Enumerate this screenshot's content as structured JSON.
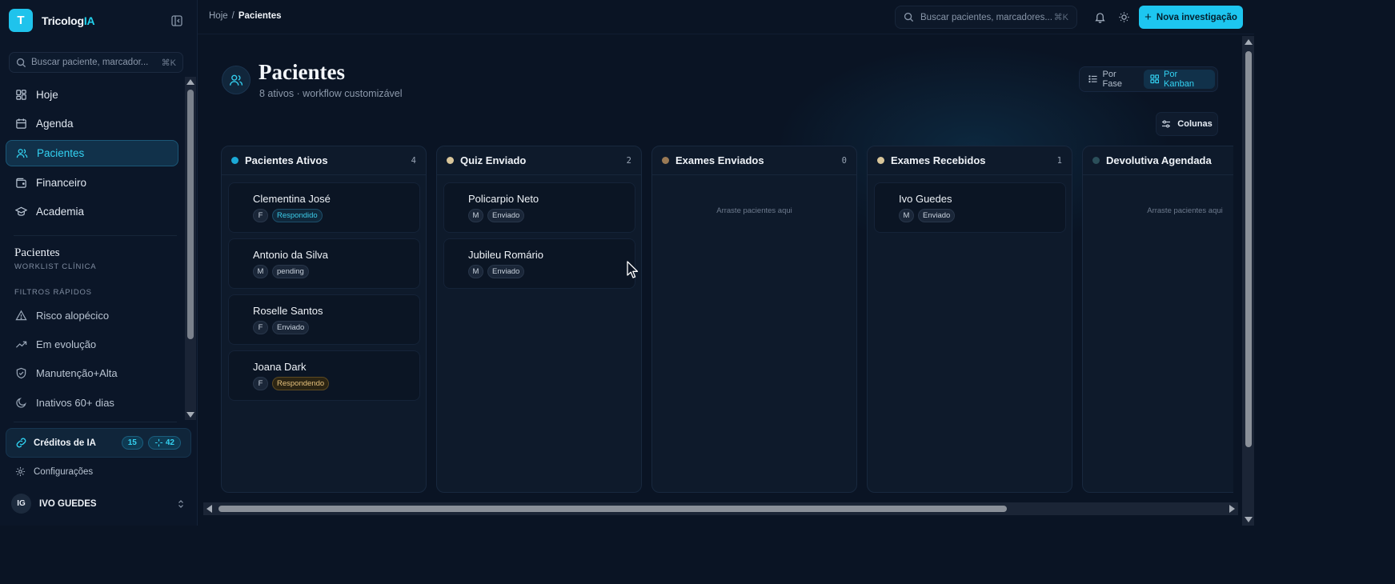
{
  "app": {
    "brand_prefix": "Tricolog",
    "brand_accent": "IA",
    "logo_letter": "T"
  },
  "sidebar": {
    "search_placeholder": "Buscar paciente, marcador...",
    "search_shortcut": "⌘K",
    "nav": [
      {
        "label": "Hoje",
        "icon": "dashboard-icon"
      },
      {
        "label": "Agenda",
        "icon": "calendar-icon"
      },
      {
        "label": "Pacientes",
        "icon": "users-icon",
        "active": true
      },
      {
        "label": "Financeiro",
        "icon": "wallet-icon"
      },
      {
        "label": "Academia",
        "icon": "graduation-cap-icon"
      }
    ],
    "section_title": "Pacientes",
    "section_subtitle": "WORKLIST CLÍNICA",
    "quick_filters_label": "FILTROS RÁPIDOS",
    "filters": [
      {
        "label": "Risco alopécico",
        "icon": "alert-triangle-icon"
      },
      {
        "label": "Em evolução",
        "icon": "trending-up-icon"
      },
      {
        "label": "Manutenção+Alta",
        "icon": "shield-check-icon"
      },
      {
        "label": "Inativos 60+ dias",
        "icon": "moon-icon"
      }
    ],
    "credits": {
      "label": "Créditos de IA",
      "badge_a": "15",
      "badge_b": "42"
    },
    "settings_label": "Configurações",
    "user": {
      "initials": "IG",
      "name": "IVO GUEDES"
    }
  },
  "topbar": {
    "breadcrumb_root": "Hoje",
    "breadcrumb_sep": "/",
    "breadcrumb_current": "Pacientes",
    "search_placeholder": "Buscar pacientes, marcadores...",
    "search_shortcut": "⌘K",
    "new_button": "Nova investigação"
  },
  "page": {
    "title": "Pacientes",
    "subtitle": "8 ativos · workflow customizável",
    "view_phase": "Por Fase",
    "view_kanban": "Por Kanban",
    "columns_button": "Colunas"
  },
  "colors": {
    "accent": "#1dc6f0",
    "dot_active": "#1ba9d6",
    "dot_quiz": "#d8c59a",
    "dot_exams_sent": "#9a7a55",
    "dot_exams_received": "#d8c59a",
    "dot_devolutiva": "#2b4f5a"
  },
  "board": {
    "empty_text": "Arraste pacientes aqui",
    "columns": [
      {
        "title": "Pacientes Ativos",
        "count": "4",
        "cards": [
          {
            "name": "Clementina José",
            "sex": "F",
            "status": "Respondido"
          },
          {
            "name": "Antonio da Silva",
            "sex": "M",
            "status": "pending"
          },
          {
            "name": "Roselle Santos",
            "sex": "F",
            "status": "Enviado"
          },
          {
            "name": "Joana Dark",
            "sex": "F",
            "status": "Respondendo"
          }
        ]
      },
      {
        "title": "Quiz Enviado",
        "count": "2",
        "cards": [
          {
            "name": "Policarpio Neto",
            "sex": "M",
            "status": "Enviado"
          },
          {
            "name": "Jubileu Romário",
            "sex": "M",
            "status": "Enviado"
          }
        ]
      },
      {
        "title": "Exames Enviados",
        "count": "0",
        "cards": []
      },
      {
        "title": "Exames Recebidos",
        "count": "1",
        "cards": [
          {
            "name": "Ivo Guedes",
            "sex": "M",
            "status": "Enviado"
          }
        ]
      },
      {
        "title": "Devolutiva Agendada",
        "count": "",
        "cards": []
      }
    ]
  }
}
